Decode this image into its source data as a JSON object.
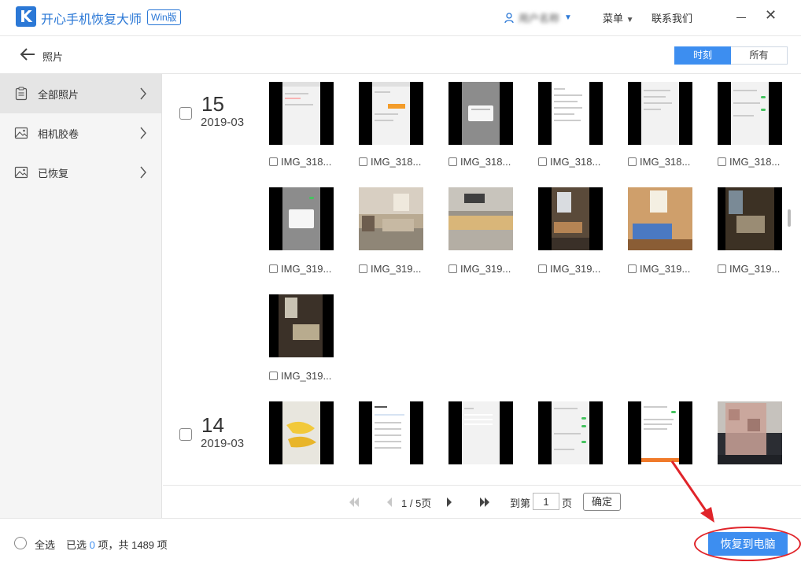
{
  "app": {
    "title": "开心手机恢复大师",
    "badge": "Win版"
  },
  "header": {
    "user_name": "用户名称",
    "menu_label": "菜单",
    "contact_label": "联系我们"
  },
  "subheader": {
    "title": "照片",
    "view_tabs": [
      "时刻",
      "所有"
    ],
    "active_view": "时刻"
  },
  "sidebar": {
    "items": [
      {
        "label": "全部照片",
        "icon": "clipboard-icon",
        "active": true
      },
      {
        "label": "相机胶卷",
        "icon": "image-icon",
        "active": false
      },
      {
        "label": "已恢复",
        "icon": "image-icon",
        "active": false
      }
    ]
  },
  "groups": [
    {
      "day": "15",
      "month": "2019-03",
      "photos": [
        {
          "name": "IMG_318..."
        },
        {
          "name": "IMG_318..."
        },
        {
          "name": "IMG_318..."
        },
        {
          "name": "IMG_318..."
        },
        {
          "name": "IMG_318..."
        },
        {
          "name": "IMG_318..."
        },
        {
          "name": "IMG_319..."
        },
        {
          "name": "IMG_319..."
        },
        {
          "name": "IMG_319..."
        },
        {
          "name": "IMG_319..."
        },
        {
          "name": "IMG_319..."
        },
        {
          "name": "IMG_319..."
        },
        {
          "name": "IMG_319..."
        }
      ]
    },
    {
      "day": "14",
      "month": "2019-03",
      "photos": [
        {
          "name": ""
        },
        {
          "name": ""
        },
        {
          "name": ""
        },
        {
          "name": ""
        },
        {
          "name": ""
        },
        {
          "name": ""
        }
      ]
    }
  ],
  "pager": {
    "page_info": "1 / 5页",
    "goto_label": "到第",
    "current_page": "1",
    "unit_label": "页",
    "confirm_label": "确定"
  },
  "footer": {
    "select_all_label": "全选",
    "selected_prefix": "已选",
    "selected_count": "0",
    "selected_suffix": "项，共 1489 项",
    "recover_label": "恢复到电脑"
  },
  "colors": {
    "accent": "#3d8ef0",
    "brand": "#2b78d6",
    "highlight": "#e0242a"
  }
}
